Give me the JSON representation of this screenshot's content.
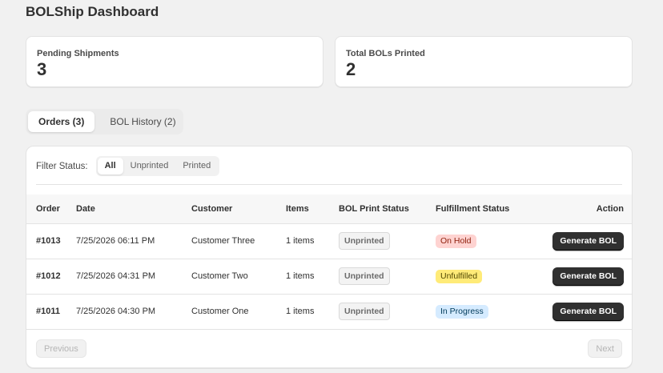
{
  "page": {
    "title": "BOLShip Dashboard"
  },
  "stats": [
    {
      "label": "Pending Shipments",
      "value": "3"
    },
    {
      "label": "Total BOLs Printed",
      "value": "2"
    }
  ],
  "tabs": [
    {
      "label": "Orders (3)",
      "active": true
    },
    {
      "label": "BOL History (2)",
      "active": false
    }
  ],
  "filter": {
    "label": "Filter Status:",
    "options": [
      {
        "label": "All",
        "active": true
      },
      {
        "label": "Unprinted",
        "active": false
      },
      {
        "label": "Printed",
        "active": false
      }
    ]
  },
  "table": {
    "headers": {
      "order": "Order",
      "date": "Date",
      "customer": "Customer",
      "items": "Items",
      "print_status": "BOL Print Status",
      "fulfillment": "Fulfillment Status",
      "action": "Action"
    },
    "rows": [
      {
        "order": "#1013",
        "date": "7/25/2026 06:11 PM",
        "customer": "Customer Three",
        "items": "1 items",
        "print_status": "Unprinted",
        "fulfillment": "On Hold",
        "fulfillment_bg": "#fed3d1",
        "fulfillment_fg": "#8e1f0b",
        "action": "Generate BOL"
      },
      {
        "order": "#1012",
        "date": "7/25/2026 04:31 PM",
        "customer": "Customer Two",
        "items": "1 items",
        "print_status": "Unprinted",
        "fulfillment": "Unfulfilled",
        "fulfillment_bg": "#ffeb78",
        "fulfillment_fg": "#4f4700",
        "action": "Generate BOL"
      },
      {
        "order": "#1011",
        "date": "7/25/2026 04:30 PM",
        "customer": "Customer One",
        "items": "1 items",
        "print_status": "Unprinted",
        "fulfillment": "In Progress",
        "fulfillment_bg": "#d5ebff",
        "fulfillment_fg": "#003a5a",
        "action": "Generate BOL"
      }
    ]
  },
  "pagination": {
    "previous": "Previous",
    "next": "Next"
  }
}
